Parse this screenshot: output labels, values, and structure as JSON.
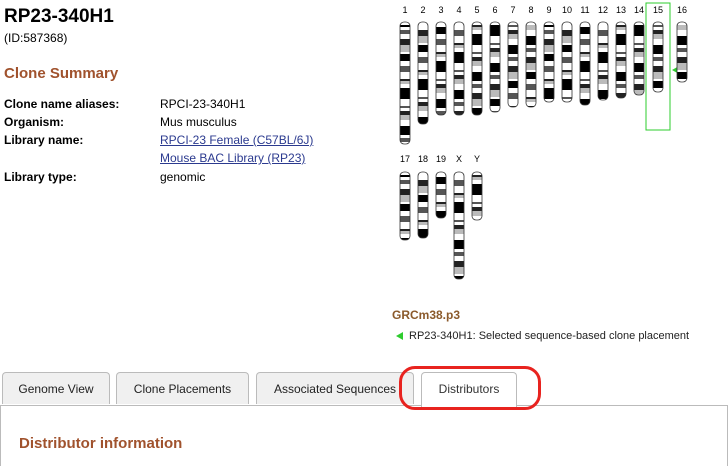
{
  "clone": {
    "title": "RP23-340H1",
    "id": "(ID:587368)"
  },
  "summary": {
    "heading": "Clone Summary",
    "rows": [
      {
        "label": "Clone name aliases:",
        "value": "RPCI-23-340H1"
      },
      {
        "label": "Organism:",
        "value": "Mus musculus"
      },
      {
        "label": "Library name:",
        "links": [
          "RPCI-23 Female (C57BL/6J)",
          "Mouse BAC Library (RP23)"
        ]
      },
      {
        "label": "Library type:",
        "value": "genomic"
      }
    ]
  },
  "idiogram": {
    "chromosomes": [
      "1",
      "2",
      "3",
      "4",
      "5",
      "6",
      "7",
      "8",
      "9",
      "10",
      "11",
      "12",
      "13",
      "14",
      "15",
      "16",
      "17",
      "18",
      "19",
      "X",
      "Y"
    ],
    "selected_chromosome": "15",
    "highlight_color": "#2ecc2e"
  },
  "assembly": {
    "name": "GRCm38.p3",
    "legend": "RP23-340H1: Selected sequence-based clone placement"
  },
  "tabs": [
    {
      "label": "Genome View",
      "active": false
    },
    {
      "label": "Clone Placements",
      "active": false
    },
    {
      "label": "Associated Sequences",
      "active": false
    },
    {
      "label": "Distributors",
      "active": true
    }
  ],
  "panel": {
    "heading": "Distributor information"
  },
  "colors": {
    "heading": "#a0522d",
    "link": "#2b3a8f",
    "annotation_ring": "#e8231f"
  }
}
